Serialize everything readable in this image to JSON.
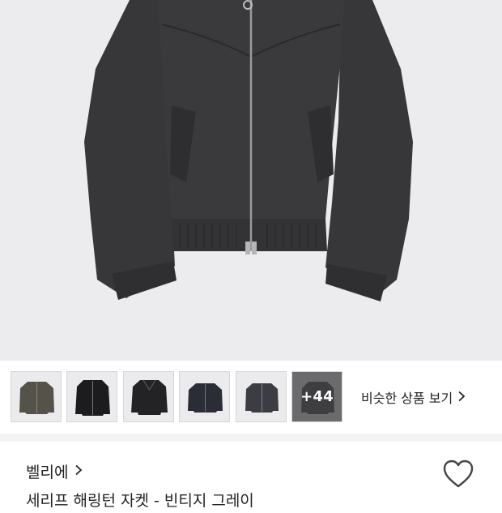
{
  "product_image": {
    "icon": "charcoal-zip-jacket-photo",
    "background_color": "#ececee",
    "jacket_color": "#3a3a3d"
  },
  "thumbnails": [
    {
      "icon": "olive-bomber-jacket-thumbnail",
      "color": "#55524a"
    },
    {
      "icon": "black-zip-jacket-thumbnail",
      "color": "#1c1c1e"
    },
    {
      "icon": "black-leather-jacket-thumbnail",
      "color": "#232325"
    },
    {
      "icon": "navy-harrington-jacket-thumbnail",
      "color": "#2a2d36"
    },
    {
      "icon": "charcoal-padded-jacket-thumbnail",
      "color": "#3c3d42"
    }
  ],
  "more_thumbnails": {
    "label": "+44"
  },
  "similar_link": {
    "label": "비슷한 상품 보기"
  },
  "brand": {
    "name": "벨리에"
  },
  "product": {
    "title": "세리프 해링턴 자켓 - 빈티지 그레이"
  }
}
